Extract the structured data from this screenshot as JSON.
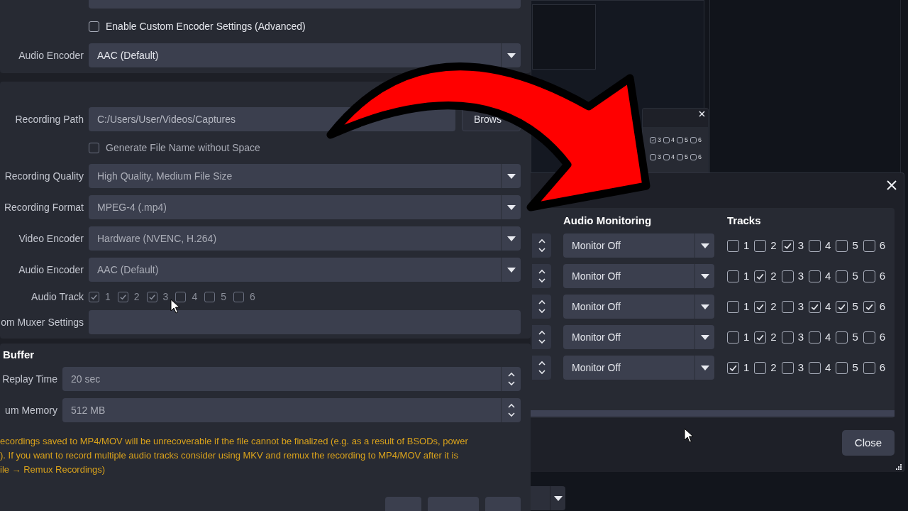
{
  "output": {
    "custom_encoder": {
      "label": "Enable Custom Encoder Settings (Advanced)",
      "checked": false
    },
    "audio_encoder": {
      "label": "Audio Encoder",
      "value": "AAC (Default)"
    }
  },
  "recording": {
    "path": {
      "label": "Recording Path",
      "value": "C:/Users/User/Videos/Captures",
      "button": "Brows"
    },
    "no_space": {
      "label": "Generate File Name without Space",
      "checked": false
    },
    "dropdowns": [
      {
        "label": "Recording Quality",
        "value": "High Quality, Medium File Size"
      },
      {
        "label": "Recording Format",
        "value": "MPEG-4 (.mp4)"
      },
      {
        "label": "Video Encoder",
        "value": "Hardware (NVENC, H.264)"
      },
      {
        "label": "Audio Encoder",
        "value": "AAC (Default)"
      }
    ],
    "audio_track": {
      "label": "Audio Track",
      "disabled": true,
      "tracks": [
        {
          "label": "1",
          "checked": true
        },
        {
          "label": "2",
          "checked": true
        },
        {
          "label": "3",
          "checked": true
        },
        {
          "label": "4",
          "checked": false
        },
        {
          "label": "5",
          "checked": false
        },
        {
          "label": "6",
          "checked": false
        }
      ]
    },
    "muxer": {
      "label": "om Muxer Settings"
    }
  },
  "replay_buffer": {
    "title": "Buffer",
    "fields": [
      {
        "label": "Replay Time",
        "value": "20 sec"
      },
      {
        "label": "um Memory",
        "value": "512 MB"
      }
    ]
  },
  "warning_lines": [
    "ecordings saved to MP4/MOV will be unrecoverable if the file cannot be finalized (e.g. as a result of BSODs, power",
    "). If you want to record multiple audio tracks consider using MKV and remux the recording to MP4/MOV after it is",
    "ile → Remux Recordings)"
  ],
  "background_window": {
    "rows": [
      {
        "tracks": [
          {
            "label": "3",
            "checked": true
          },
          {
            "label": "4",
            "checked": false
          },
          {
            "label": "5",
            "checked": false
          },
          {
            "label": "6",
            "checked": false
          }
        ]
      },
      {
        "tracks": [
          {
            "label": "3",
            "checked": false
          },
          {
            "label": "4",
            "checked": false
          },
          {
            "label": "5",
            "checked": false
          },
          {
            "label": "6",
            "checked": false
          }
        ]
      }
    ]
  },
  "dialog": {
    "headers": [
      "Audio Monitoring",
      "Tracks"
    ],
    "rows": [
      {
        "monitoring": "Monitor Off",
        "tracks": [
          {
            "label": "1",
            "checked": false
          },
          {
            "label": "2",
            "checked": false
          },
          {
            "label": "3",
            "checked": true
          },
          {
            "label": "4",
            "checked": false
          },
          {
            "label": "5",
            "checked": false
          },
          {
            "label": "6",
            "checked": false
          }
        ]
      },
      {
        "monitoring": "Monitor Off",
        "tracks": [
          {
            "label": "1",
            "checked": false
          },
          {
            "label": "2",
            "checked": true
          },
          {
            "label": "3",
            "checked": false
          },
          {
            "label": "4",
            "checked": false
          },
          {
            "label": "5",
            "checked": false
          },
          {
            "label": "6",
            "checked": false
          }
        ]
      },
      {
        "monitoring": "Monitor Off",
        "tracks": [
          {
            "label": "1",
            "checked": false
          },
          {
            "label": "2",
            "checked": true
          },
          {
            "label": "3",
            "checked": false
          },
          {
            "label": "4",
            "checked": true
          },
          {
            "label": "5",
            "checked": true
          },
          {
            "label": "6",
            "checked": true
          }
        ]
      },
      {
        "monitoring": "Monitor Off",
        "tracks": [
          {
            "label": "1",
            "checked": false
          },
          {
            "label": "2",
            "checked": true
          },
          {
            "label": "3",
            "checked": false
          },
          {
            "label": "4",
            "checked": false
          },
          {
            "label": "5",
            "checked": false
          },
          {
            "label": "6",
            "checked": false
          }
        ]
      },
      {
        "monitoring": "Monitor Off",
        "tracks": [
          {
            "label": "1",
            "checked": true
          },
          {
            "label": "2",
            "checked": false
          },
          {
            "label": "3",
            "checked": false
          },
          {
            "label": "4",
            "checked": false
          },
          {
            "label": "5",
            "checked": false
          },
          {
            "label": "6",
            "checked": false
          }
        ]
      }
    ],
    "close_button": "Close"
  }
}
